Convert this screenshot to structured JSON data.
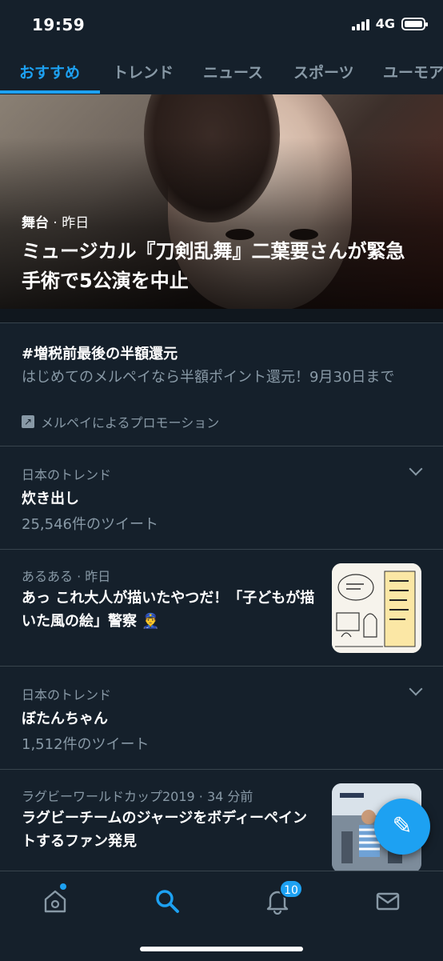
{
  "status": {
    "time": "19:59",
    "network": "4G"
  },
  "tabs": [
    {
      "label": "おすすめ",
      "active": true
    },
    {
      "label": "トレンド"
    },
    {
      "label": "ニュース"
    },
    {
      "label": "スポーツ"
    },
    {
      "label": "ユーモア"
    }
  ],
  "hero": {
    "category": "舞台",
    "time": "· 昨日",
    "title": "ミュージカル『刀剣乱舞』二葉要さんが緊急手術で5公演を中止"
  },
  "promo": {
    "title": "#増税前最後の半額還元",
    "body": "はじめてのメルペイなら半額ポイント還元！9月30日まで",
    "tag": "メルペイによるプロモーション"
  },
  "trends": [
    {
      "meta": "日本のトレンド",
      "title": "炊き出し",
      "count": "25,546件のツイート"
    },
    {
      "meta": "あるある · 昨日",
      "title": "あっ これ大人が描いたやつだ！「子どもが描いた風の絵」警察 👮‍♂️"
    },
    {
      "meta": "日本のトレンド",
      "title": "ぼたんちゃん",
      "count": "1,512件のツイート"
    },
    {
      "meta": "ラグビーワールドカップ2019 · 34 分前",
      "title": "ラグビーチームのジャージをボディーペイントするファン発見"
    }
  ],
  "nav": {
    "badge": "10"
  },
  "colors": {
    "background": "#15202b",
    "accent": "#1da1f2",
    "muted": "#8899a6",
    "divider": "#38444d"
  }
}
